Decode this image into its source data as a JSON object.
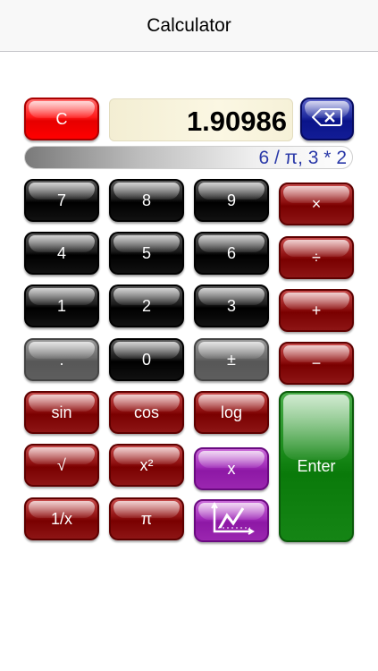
{
  "navbar": {
    "title": "Calculator"
  },
  "display": {
    "value": "1.90986",
    "history": "6 / π, 3 * 2"
  },
  "keys": {
    "clear": "C",
    "seven": "7",
    "eight": "8",
    "nine": "9",
    "four": "4",
    "five": "5",
    "six": "6",
    "one": "1",
    "two": "2",
    "three": "3",
    "decimal": ".",
    "zero": "0",
    "plus_minus": "±",
    "multiply": "×",
    "divide": "÷",
    "add": "+",
    "subtract": "−",
    "sin": "sin",
    "cos": "cos",
    "log": "log",
    "sqrt": "√",
    "square": "x²",
    "variable_x": "x",
    "reciprocal": "1/x",
    "pi": "π",
    "enter": "Enter"
  },
  "icons": {
    "backspace": "backspace-icon",
    "graph": "graph-icon"
  },
  "colors": {
    "digit": "#000000",
    "operator": "#8b0000",
    "clear": "#ff0000",
    "backspace": "#1e2a9e",
    "function": "#8b0000",
    "variable": "#a02ab8",
    "enter": "#1a8a1a",
    "history_text": "#2a39a8"
  }
}
